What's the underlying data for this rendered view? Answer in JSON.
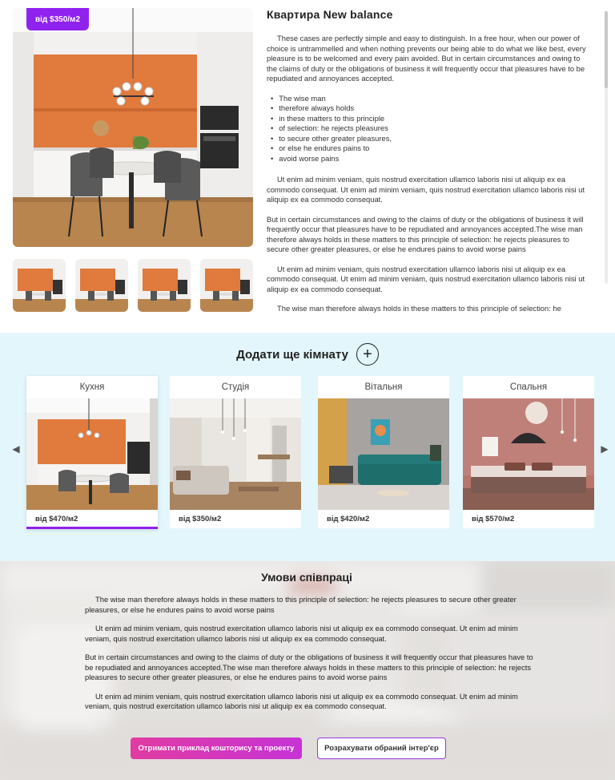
{
  "apartment": {
    "price_badge": "від $350/м2",
    "title": "Квартира New balance",
    "paragraph1": "These cases are perfectly simple and easy to distinguish. In a free hour, when our power of choice is untrammelled and when nothing prevents our being able to do what we like best, every pleasure is to be welcomed and every pain avoided. But in certain circumstances and owing to the claims of duty or the obligations of business it will frequently occur that pleasures have to be repudiated and annoyances accepted.",
    "bullets": [
      "The wise man",
      "therefore always holds",
      "in these matters to this principle",
      "of selection: he rejects pleasures",
      "to secure other greater pleasures,",
      "or else he endures pains to",
      "avoid worse pains"
    ],
    "paragraph2": "Ut enim ad minim veniam, quis nostrud exercitation ullamco laboris nisi ut aliquip ex ea commodo consequat. Ut enim ad minim veniam, quis nostrud exercitation ullamco laboris nisi ut aliquip ex ea commodo consequat.",
    "paragraph3": "But in certain circumstances and owing to the claims of duty or the obligations of business it will frequently occur that pleasures have to be repudiated and annoyances accepted.The wise man therefore always holds in these matters to this principle of selection: he rejects pleasures to secure other greater pleasures, or else he endures pains to avoid worse pains",
    "paragraph4": "Ut enim ad minim veniam, quis nostrud exercitation ullamco laboris nisi ut aliquip ex ea commodo consequat. Ut enim ad minim veniam, quis nostrud exercitation ullamco laboris nisi ut aliquip ex ea commodo consequat.",
    "paragraph5": "The wise man therefore always holds in these matters to this principle of selection: he"
  },
  "rooms": {
    "add_title": "Додати ще кімнату",
    "add_icon": "plus-circle-icon",
    "add_symbol": "+",
    "prev_symbol": "◀",
    "next_symbol": "▶",
    "cards": [
      {
        "title": "Кухня",
        "price": "від $470/м2"
      },
      {
        "title": "Студія",
        "price": "від $350/м2"
      },
      {
        "title": "Вітальня",
        "price": "від $420/м2"
      },
      {
        "title": "Спальня",
        "price": "від $570/м2"
      }
    ]
  },
  "terms": {
    "title": "Умови співпраці",
    "p1": "The wise man therefore always holds in these matters to this principle of selection: he rejects pleasures to secure other greater pleasures, or else he endures pains to avoid worse pains",
    "p2": "Ut enim ad minim veniam, quis nostrud exercitation ullamco laboris nisi ut aliquip ex ea commodo consequat. Ut enim ad minim veniam, quis nostrud exercitation ullamco laboris nisi ut aliquip ex ea commodo consequat.",
    "p3": "But in certain circumstances and owing to the claims of duty or the obligations of business it will frequently occur that pleasures have to be repudiated and annoyances accepted.The wise man therefore always holds in these matters to this principle of selection: he rejects pleasures to secure other greater pleasures, or else he endures pains to avoid worse pains",
    "p4": "Ut enim ad minim veniam, quis nostrud exercitation ullamco laboris nisi ut aliquip ex ea commodo consequat. Ut enim ad minim veniam, quis nostrud exercitation ullamco laboris nisi ut aliquip ex ea commodo consequat.",
    "primary_button": "Отримати приклад кошторису та проекту",
    "secondary_button": "Розрахувати обраний інтер'єр"
  },
  "colors": {
    "accent_purple": "#8f22ef",
    "rooms_bg": "#e3f6fb",
    "gradient_start": "#e13ba2",
    "gradient_end": "#c633d6"
  }
}
